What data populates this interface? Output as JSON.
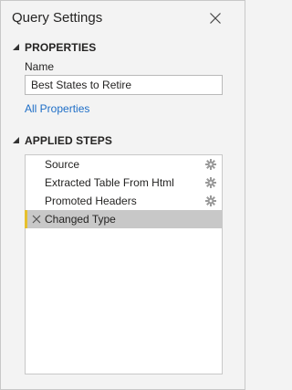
{
  "panel": {
    "title": "Query Settings"
  },
  "properties": {
    "heading": "PROPERTIES",
    "name_label": "Name",
    "name_value": "Best States to Retire",
    "all_properties_link": "All Properties"
  },
  "applied_steps": {
    "heading": "APPLIED STEPS",
    "steps": [
      {
        "label": "Source",
        "has_settings": true,
        "selected": false
      },
      {
        "label": "Extracted Table From Html",
        "has_settings": true,
        "selected": false
      },
      {
        "label": "Promoted Headers",
        "has_settings": true,
        "selected": false
      },
      {
        "label": "Changed Type",
        "has_settings": false,
        "selected": true
      }
    ]
  },
  "icons": {
    "close": "close-icon",
    "collapse": "caret-down-icon",
    "step_settings": "gear-icon",
    "delete_step": "delete-x-icon"
  },
  "colors": {
    "background": "#f3f3f3",
    "link": "#1e6ec7",
    "selected_row": "#c8c8c8",
    "selected_marker": "#e6c02d"
  }
}
